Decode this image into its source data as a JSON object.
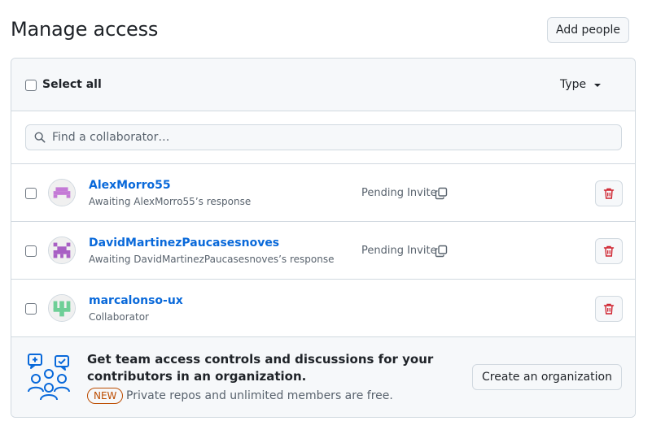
{
  "page": {
    "title": "Manage access",
    "add_people_label": "Add people"
  },
  "header": {
    "select_all_label": "Select all",
    "type_filter_label": "Type"
  },
  "search": {
    "placeholder": "Find a collaborator…",
    "value": ""
  },
  "members": [
    {
      "username": "AlexMorro55",
      "subtitle": "Awaiting AlexMorro55’s response",
      "status": "Pending Invite",
      "avatar_color": "#c47ad6"
    },
    {
      "username": "DavidMartinezPaucasesnoves",
      "subtitle": "Awaiting DavidMartinezPaucasesnoves’s response",
      "status": "Pending Invite",
      "avatar_color": "#a85fc4"
    },
    {
      "username": "marcalonso-ux",
      "subtitle": "Collaborator",
      "status": "",
      "avatar_color": "#6fcf97"
    }
  ],
  "promo": {
    "title": "Get team access controls and discussions for your contributors in an organization.",
    "badge": "NEW",
    "note": "Private repos and unlimited members are free.",
    "button_label": "Create an organization"
  },
  "icons": {
    "search": "search-icon",
    "caret": "caret-down-icon",
    "copy": "copy-icon",
    "trash": "trash-icon",
    "organization": "people-discussion-illustration"
  },
  "colors": {
    "link": "#0969da",
    "danger": "#cf222e",
    "accent_promo": "#0969da",
    "new_badge": "#bc4c00"
  }
}
